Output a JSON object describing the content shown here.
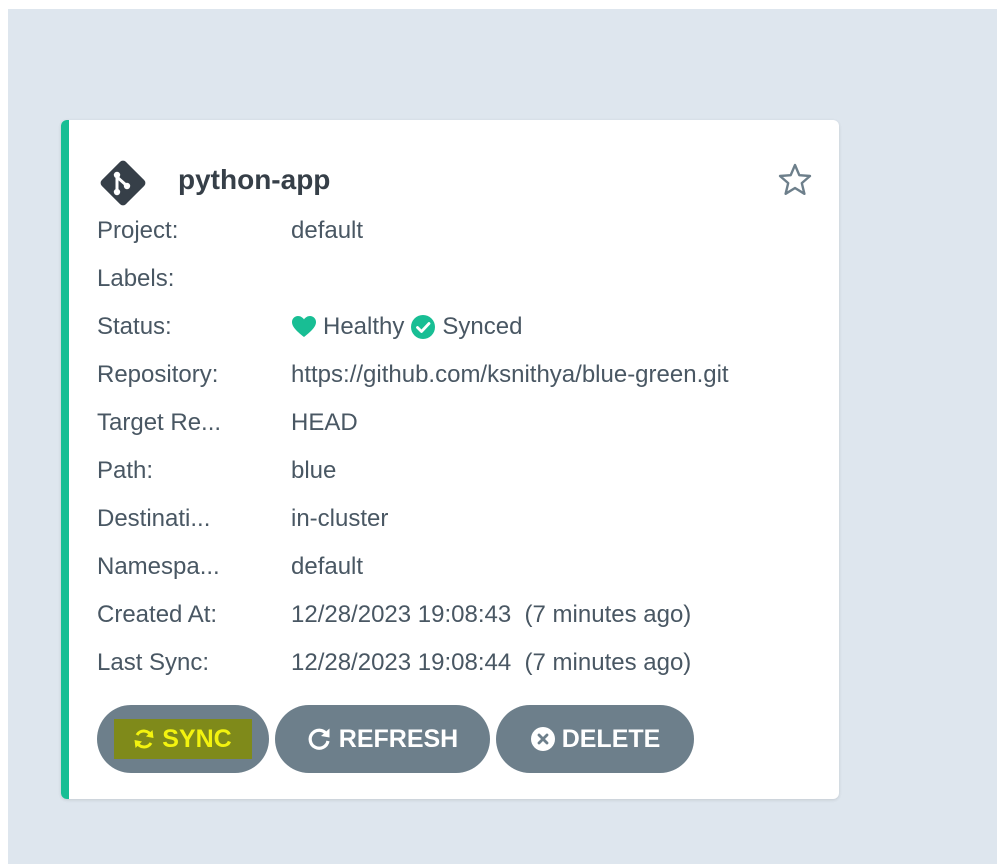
{
  "app": {
    "name": "python-app",
    "icon": "git-diamond-icon",
    "favorite_icon": "star-outline-icon"
  },
  "fields": [
    {
      "label": "Project:",
      "value": "default"
    },
    {
      "label": "Labels:",
      "value": ""
    },
    {
      "label": "Status:",
      "health": "Healthy",
      "sync": "Synced"
    },
    {
      "label": "Repository:",
      "value": "https://github.com/ksnithya/blue-green.git"
    },
    {
      "label": "Target Re...",
      "value": "HEAD"
    },
    {
      "label": "Path:",
      "value": "blue"
    },
    {
      "label": "Destinati...",
      "value": "in-cluster"
    },
    {
      "label": "Namespa...",
      "value": "default"
    },
    {
      "label": "Created At:",
      "value": "12/28/2023 19:08:43  (7 minutes ago)"
    },
    {
      "label": "Last Sync:",
      "value": "12/28/2023 19:08:44  (7 minutes ago)"
    }
  ],
  "buttons": {
    "sync": "SYNC",
    "refresh": "REFRESH",
    "delete": "DELETE"
  },
  "colors": {
    "accent": "#18be94",
    "button_bg": "#6d7f8b",
    "highlight_bg": "#7f8a1a",
    "highlight_text": "#f3f30f",
    "background": "#dee6ee"
  }
}
